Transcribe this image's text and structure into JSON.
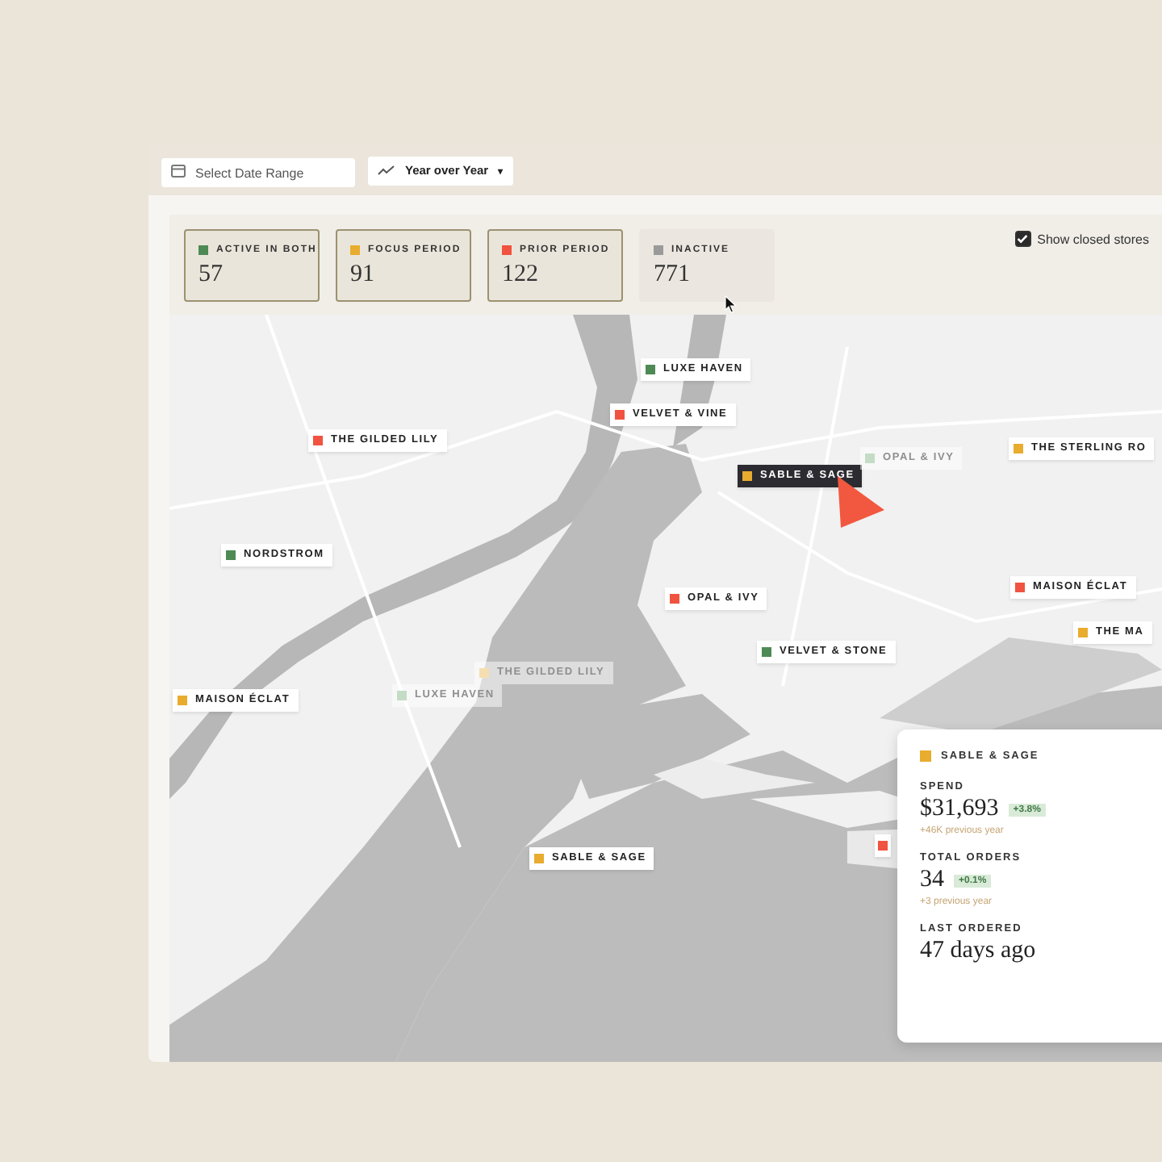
{
  "toolbar": {
    "date_range": {
      "placeholder": "Select Date Range"
    },
    "comparison": {
      "label": "Year over Year",
      "caret": "▾"
    }
  },
  "stats": [
    {
      "label": "ACTIVE IN BOTH",
      "value": "57",
      "color": "#4e8a55",
      "on": true
    },
    {
      "label": "FOCUS PERIOD",
      "value": "91",
      "color": "#e8ac2e",
      "on": true
    },
    {
      "label": "PRIOR PERIOD",
      "value": "122",
      "color": "#f0533f",
      "on": true
    },
    {
      "label": "INACTIVE",
      "value": "771",
      "color": "#9a9a9a",
      "on": false
    }
  ],
  "show_closed_stores": {
    "label": "Show closed stores",
    "checked": true
  },
  "pins": [
    {
      "name": "LUXE HAVEN",
      "color": "#4e8a55",
      "selected": false,
      "faded": false
    },
    {
      "name": "VELVET & VINE",
      "color": "#f0533f",
      "selected": false,
      "faded": false
    },
    {
      "name": "THE GILDED LILY",
      "color": "#f0533f",
      "selected": false,
      "faded": false
    },
    {
      "name": "SABLE & SAGE",
      "color": "#e8ac2e",
      "selected": true,
      "faded": false
    },
    {
      "name": "OPAL & IVY",
      "color": "#c4dcc6",
      "selected": false,
      "faded": true
    },
    {
      "name": "THE STERLING RO",
      "color": "#e8ac2e",
      "selected": false,
      "faded": false
    },
    {
      "name": "NORDSTROM",
      "color": "#4e8a55",
      "selected": false,
      "faded": false
    },
    {
      "name": "OPAL & IVY",
      "color": "#f0533f",
      "selected": false,
      "faded": false
    },
    {
      "name": "MAISON ÉCLAT",
      "color": "#f0533f",
      "selected": false,
      "faded": false
    },
    {
      "name": "THE MA",
      "color": "#e8ac2e",
      "selected": false,
      "faded": false
    },
    {
      "name": "VELVET & STONE",
      "color": "#4e8a55",
      "selected": false,
      "faded": false
    },
    {
      "name": "THE GILDED LILY",
      "color": "#f6deb0",
      "selected": false,
      "faded": true
    },
    {
      "name": "LUXE HAVEN",
      "color": "#c4dcc6",
      "selected": false,
      "faded": true
    },
    {
      "name": "MAISON ÉCLAT",
      "color": "#e8ac2e",
      "selected": false,
      "faded": false
    },
    {
      "name": "SABLE & SAGE",
      "color": "#e8ac2e",
      "selected": false,
      "faded": false
    },
    {
      "color": "#f0533f",
      "selected": false,
      "faded": false
    }
  ],
  "store_card": {
    "name": "SABLE & SAGE",
    "color": "#e8ac2e",
    "metrics": [
      {
        "label": "SPEND",
        "value": "$31,693",
        "change": "+3.8%",
        "note": "+46K previous year"
      },
      {
        "label": "TOTAL ORDERS",
        "value": "34",
        "change": "+0.1%",
        "note": "+3 previous year"
      },
      {
        "label": "LAST ORDERED",
        "value": "47 days ago"
      }
    ]
  }
}
